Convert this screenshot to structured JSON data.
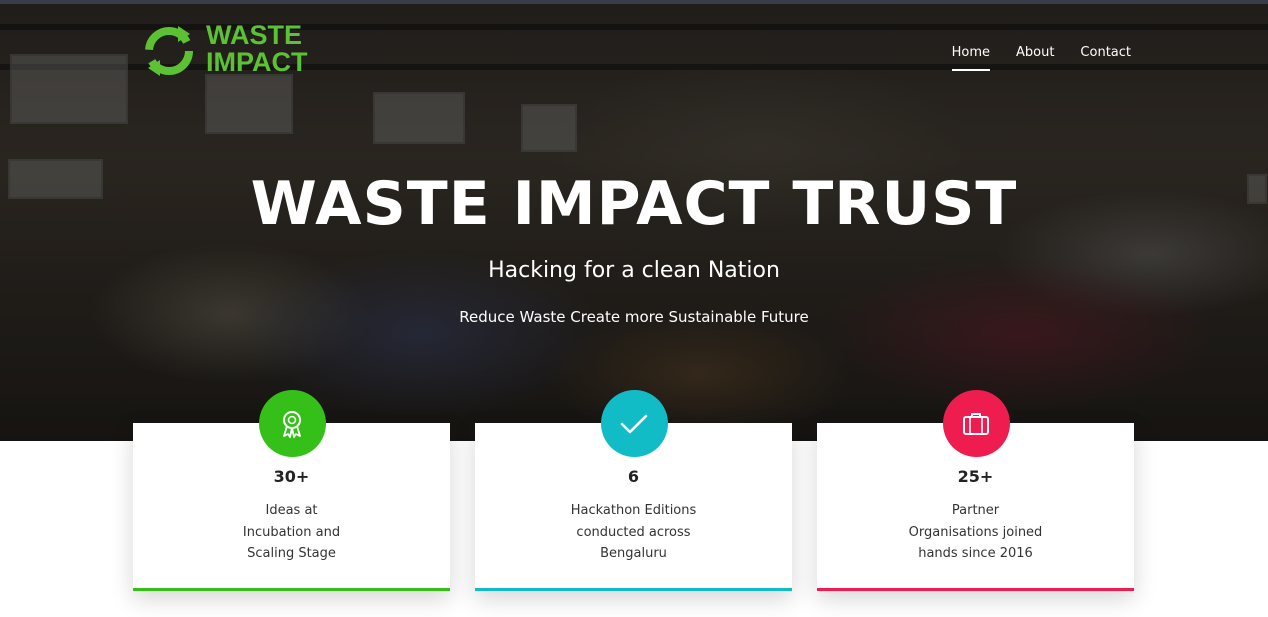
{
  "brand": {
    "logo_line1": "WASTE",
    "logo_line2": "IMPACT",
    "logo_color": "#5cc234"
  },
  "nav": {
    "items": [
      {
        "label": "Home",
        "active": true
      },
      {
        "label": "About",
        "active": false
      },
      {
        "label": "Contact",
        "active": false
      }
    ]
  },
  "hero": {
    "title": "WASTE IMPACT TRUST",
    "subtitle": "Hacking for a clean Nation",
    "tagline": "Reduce Waste Create more Sustainable Future"
  },
  "stats": [
    {
      "value": "30+",
      "lines": [
        "Ideas at",
        "Incubation and",
        "Scaling Stage"
      ],
      "color": "#34c018",
      "icon": "award-ribbon-icon"
    },
    {
      "value": "6",
      "lines": [
        "Hackathon Editions",
        "conducted across",
        "Bengaluru"
      ],
      "color": "#12bcc7",
      "icon": "checkmark-icon"
    },
    {
      "value": "25+",
      "lines": [
        "Partner",
        "Organisations joined",
        "hands since 2016"
      ],
      "color": "#ee1c4f",
      "icon": "briefcase-icon"
    }
  ]
}
